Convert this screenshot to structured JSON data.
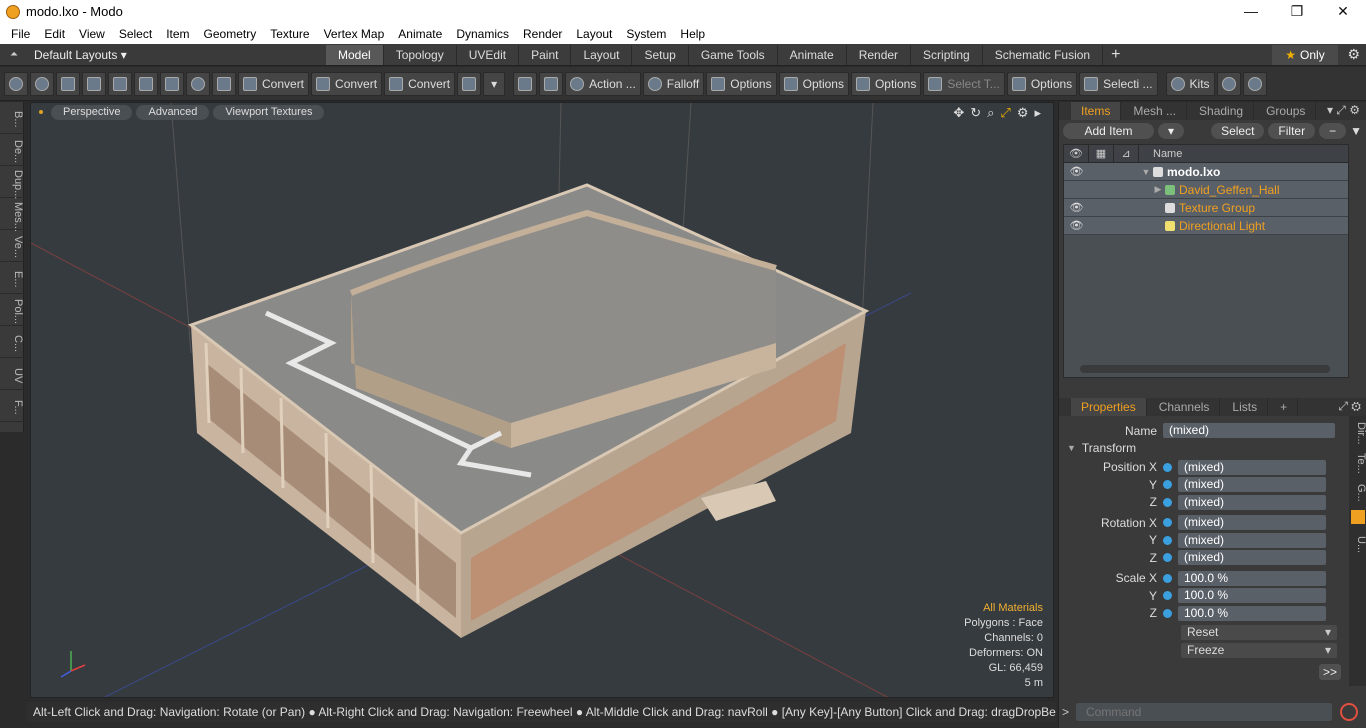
{
  "window": {
    "title": "modo.lxo - Modo",
    "minimize": "—",
    "maximize": "❐",
    "close": "✕"
  },
  "menu": [
    "File",
    "Edit",
    "View",
    "Select",
    "Item",
    "Geometry",
    "Texture",
    "Vertex Map",
    "Animate",
    "Dynamics",
    "Render",
    "Layout",
    "System",
    "Help"
  ],
  "layouts": {
    "selector": "Default Layouts ▾",
    "tabs": [
      "Model",
      "Topology",
      "UVEdit",
      "Paint",
      "Layout",
      "Setup",
      "Game Tools",
      "Animate",
      "Render",
      "Scripting",
      "Schematic Fusion"
    ],
    "active_tab": "Model",
    "only_label": "Only"
  },
  "toolbar": {
    "convert_1": "Convert",
    "convert_2": "Convert",
    "convert_3": "Convert",
    "action": "Action ...",
    "falloff": "Falloff",
    "options_1": "Options",
    "options_2": "Options",
    "options_3": "Options",
    "select_t": "Select T...",
    "options_4": "Options",
    "selecti": "Selecti ...",
    "kits": "Kits"
  },
  "left_tabs": [
    "B...",
    "De...",
    "Dup...",
    "Mes...",
    "Ve...",
    "E...",
    "Pol...",
    "C...",
    "UV",
    "F..."
  ],
  "viewport": {
    "perspective": "Perspective",
    "advanced": "Advanced",
    "textures": "Viewport Textures",
    "info": {
      "materials": "All Materials",
      "polygons": "Polygons : Face",
      "channels": "Channels: 0",
      "deformers": "Deformers: ON",
      "gl": "GL: 66,459",
      "scale": "5 m"
    }
  },
  "status": "Alt-Left Click and Drag: Navigation: Rotate (or Pan) ● Alt-Right Click and Drag: Navigation: Freewheel ● Alt-Middle Click and Drag: navRoll ● [Any Key]-[Any Button] Click and Drag: dragDropBegin",
  "items_panel": {
    "tabs": [
      "Items",
      "Mesh ...",
      "Shading",
      "Groups"
    ],
    "add_item": "Add Item",
    "select": "Select",
    "filter": "Filter",
    "name_header": "Name",
    "rows": [
      {
        "name": "modo.lxo"
      },
      {
        "name": "David_Geffen_Hall"
      },
      {
        "name": "Texture Group"
      },
      {
        "name": "Directional Light"
      }
    ]
  },
  "properties": {
    "tabs": [
      "Properties",
      "Channels",
      "Lists"
    ],
    "name_label": "Name",
    "name_value": "(mixed)",
    "transform_label": "Transform",
    "position_label": "Position X",
    "rotation_label": "Rotation X",
    "scale_label": "Scale X",
    "y": "Y",
    "z": "Z",
    "pos_x": "(mixed)",
    "pos_y": "(mixed)",
    "pos_z": "(mixed)",
    "rot_x": "(mixed)",
    "rot_y": "(mixed)",
    "rot_z": "(mixed)",
    "scl_x": "100.0 %",
    "scl_y": "100.0 %",
    "scl_z": "100.0 %",
    "reset": "Reset",
    "freeze": "Freeze",
    "more": ">>",
    "side_tabs": [
      "Dir...",
      "Te...",
      "G...",
      "U..."
    ]
  },
  "command": {
    "placeholder": "Command",
    "prompt": ">"
  }
}
